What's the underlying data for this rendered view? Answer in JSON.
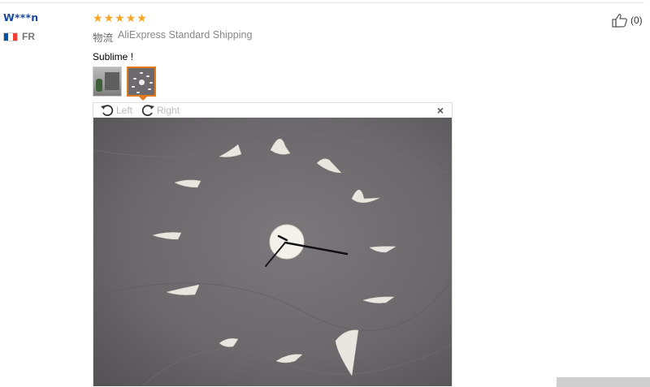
{
  "reviewer": {
    "name": "W***n",
    "country_code": "FR",
    "flag_colors": [
      "#0055a4",
      "#ffffff",
      "#ef4135"
    ]
  },
  "review": {
    "rating": 5,
    "rating_max": 5,
    "star_color": "#f5a623",
    "shipping_key": "物流",
    "shipping_value": "AliExpress Standard Shipping",
    "text": "Sublime !",
    "selected_thumbnail": 2
  },
  "viewer": {
    "rotate_left_label": "Left",
    "rotate_right_label": "Right",
    "close_symbol": "×"
  },
  "helpful": {
    "icon": "thumbs-up-icon",
    "count": "(0)"
  },
  "colors": {
    "name_blue": "#1a4a9c",
    "selected_border": "#e07a1c",
    "photo_wall": "#6e6c6e"
  }
}
